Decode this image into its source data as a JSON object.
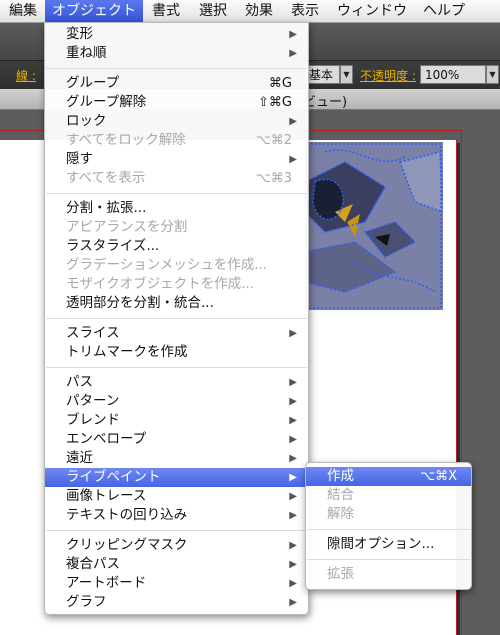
{
  "menubar": {
    "items": [
      {
        "label": "編集"
      },
      {
        "label": "オブジェクト"
      },
      {
        "label": "書式"
      },
      {
        "label": "選択"
      },
      {
        "label": "効果"
      },
      {
        "label": "表示"
      },
      {
        "label": "ウィンドウ"
      },
      {
        "label": "ヘルプ"
      }
    ]
  },
  "optionbar": {
    "stroke_label": "線 :",
    "style_value": "基本",
    "opacity_label": "不透明度 :",
    "opacity_value": "100%"
  },
  "document_tab": {
    "title_fragment": "ビュー)"
  },
  "object_menu": {
    "items": [
      {
        "label": "変形",
        "shortcut": "",
        "submenu": true,
        "disabled": false
      },
      {
        "label": "重ね順",
        "shortcut": "",
        "submenu": true,
        "disabled": false
      },
      {
        "label": "グループ",
        "shortcut": "⌘G",
        "submenu": false,
        "disabled": false
      },
      {
        "label": "グループ解除",
        "shortcut": "⇧⌘G",
        "submenu": false,
        "disabled": false
      },
      {
        "label": "ロック",
        "shortcut": "",
        "submenu": true,
        "disabled": false
      },
      {
        "label": "すべてをロック解除",
        "shortcut": "⌥⌘2",
        "submenu": false,
        "disabled": true
      },
      {
        "label": "隠す",
        "shortcut": "",
        "submenu": true,
        "disabled": false
      },
      {
        "label": "すべてを表示",
        "shortcut": "⌥⌘3",
        "submenu": false,
        "disabled": true
      },
      {
        "label": "分割・拡張...",
        "shortcut": "",
        "submenu": false,
        "disabled": false
      },
      {
        "label": "アピアランスを分割",
        "shortcut": "",
        "submenu": false,
        "disabled": true
      },
      {
        "label": "ラスタライズ...",
        "shortcut": "",
        "submenu": false,
        "disabled": false
      },
      {
        "label": "グラデーションメッシュを作成...",
        "shortcut": "",
        "submenu": false,
        "disabled": true
      },
      {
        "label": "モザイクオブジェクトを作成...",
        "shortcut": "",
        "submenu": false,
        "disabled": true
      },
      {
        "label": "透明部分を分割・統合...",
        "shortcut": "",
        "submenu": false,
        "disabled": false
      },
      {
        "label": "スライス",
        "shortcut": "",
        "submenu": true,
        "disabled": false
      },
      {
        "label": "トリムマークを作成",
        "shortcut": "",
        "submenu": false,
        "disabled": false
      },
      {
        "label": "パス",
        "shortcut": "",
        "submenu": true,
        "disabled": false
      },
      {
        "label": "パターン",
        "shortcut": "",
        "submenu": true,
        "disabled": false
      },
      {
        "label": "ブレンド",
        "shortcut": "",
        "submenu": true,
        "disabled": false
      },
      {
        "label": "エンベロープ",
        "shortcut": "",
        "submenu": true,
        "disabled": false
      },
      {
        "label": "遠近",
        "shortcut": "",
        "submenu": true,
        "disabled": false
      },
      {
        "label": "ライブペイント",
        "shortcut": "",
        "submenu": true,
        "disabled": false,
        "highlighted": true
      },
      {
        "label": "画像トレース",
        "shortcut": "",
        "submenu": true,
        "disabled": false
      },
      {
        "label": "テキストの回り込み",
        "shortcut": "",
        "submenu": true,
        "disabled": false
      },
      {
        "label": "クリッピングマスク",
        "shortcut": "",
        "submenu": true,
        "disabled": false
      },
      {
        "label": "複合パス",
        "shortcut": "",
        "submenu": true,
        "disabled": false
      },
      {
        "label": "アートボード",
        "shortcut": "",
        "submenu": true,
        "disabled": false
      },
      {
        "label": "グラフ",
        "shortcut": "",
        "submenu": true,
        "disabled": false
      }
    ]
  },
  "livepaint_submenu": {
    "items": [
      {
        "label": "作成",
        "shortcut": "⌥⌘X",
        "disabled": false,
        "highlighted": true
      },
      {
        "label": "結合",
        "shortcut": "",
        "disabled": true
      },
      {
        "label": "解除",
        "shortcut": "",
        "disabled": true
      },
      {
        "label": "隙間オプション...",
        "shortcut": "",
        "disabled": false
      },
      {
        "label": "拡張",
        "shortcut": "",
        "disabled": true
      }
    ]
  },
  "colors": {
    "menu_highlight": "#4f6ce6",
    "guide_red": "#b32020",
    "selection_blue": "#2f5bff"
  }
}
